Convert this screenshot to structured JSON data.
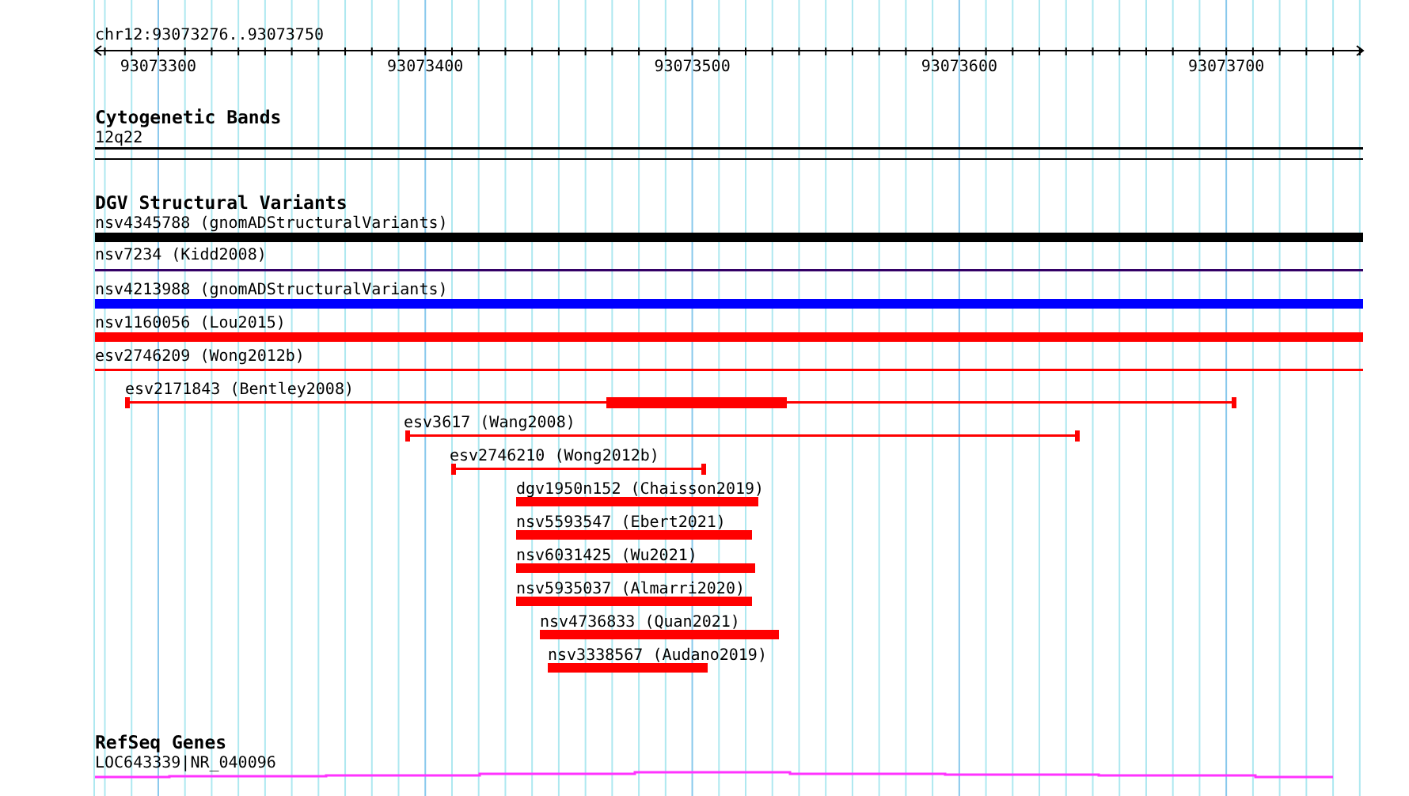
{
  "locus": "chr12:93073276..93073750",
  "ruler": {
    "labels": [
      "93073300",
      "93073400",
      "93073500",
      "93073600",
      "93073700"
    ]
  },
  "tracks": [
    {
      "title": "Cytogenetic Bands",
      "features": [
        {
          "label": "12q22",
          "kind": "line",
          "color": "#000000"
        }
      ]
    },
    {
      "title": "DGV Structural Variants",
      "features": [
        {
          "label": "nsv4345788 (gnomADStructuralVariants)",
          "kind": "bar",
          "color": "#000000"
        },
        {
          "label": "nsv7234 (Kidd2008)",
          "kind": "line",
          "color": "#330066"
        },
        {
          "label": "nsv4213988 (gnomADStructuralVariants)",
          "kind": "bar",
          "color": "#0000ff"
        },
        {
          "label": "nsv1160056 (Lou2015)",
          "kind": "bar",
          "color": "#ff0000"
        },
        {
          "label": "esv2746209 (Wong2012b)",
          "kind": "line",
          "color": "#ff0000"
        },
        {
          "label": "esv2171843 (Bentley2008)",
          "kind": "capped",
          "color": "#ff0000"
        },
        {
          "label": "esv3617 (Wang2008)",
          "kind": "capped",
          "color": "#ff0000"
        },
        {
          "label": "esv2746210 (Wong2012b)",
          "kind": "capped",
          "color": "#ff0000"
        },
        {
          "label": "dgv1950n152 (Chaisson2019)",
          "kind": "bar",
          "color": "#ff0000"
        },
        {
          "label": "nsv5593547 (Ebert2021)",
          "kind": "bar",
          "color": "#ff0000"
        },
        {
          "label": "nsv6031425 (Wu2021)",
          "kind": "bar",
          "color": "#ff0000"
        },
        {
          "label": "nsv5935037 (Almarri2020)",
          "kind": "bar",
          "color": "#ff0000"
        },
        {
          "label": "nsv4736833 (Quan2021)",
          "kind": "bar",
          "color": "#ff0000"
        },
        {
          "label": "nsv3338567 (Audano2019)",
          "kind": "bar",
          "color": "#ff0000"
        }
      ]
    },
    {
      "title": "RefSeq Genes",
      "features": [
        {
          "label": "LOC643339|NR_040096",
          "kind": "gene",
          "color": "#ff33ff"
        }
      ]
    }
  ]
}
